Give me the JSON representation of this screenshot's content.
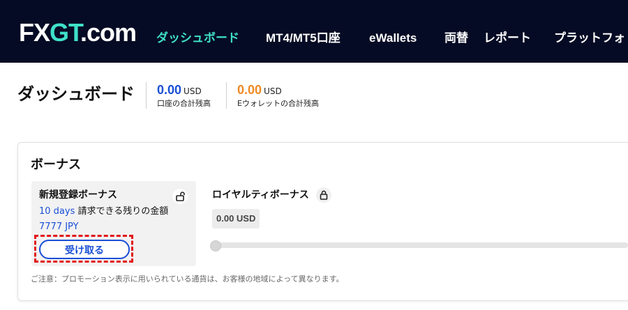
{
  "header": {
    "logo": {
      "prefix": "FX",
      "accent": "GT",
      "suffix": ".com"
    },
    "nav": [
      {
        "label": "ダッシュボード",
        "active": true
      },
      {
        "label": "MT4/MT5口座"
      },
      {
        "label": "eWallets"
      },
      {
        "label": "両替"
      },
      {
        "label": "レポート"
      },
      {
        "label": "プラットフォ"
      }
    ]
  },
  "dashboard": {
    "title": "ダッシュボード",
    "balances": [
      {
        "amount": "0.00",
        "currency": "USD",
        "label": "口座の合計残高"
      },
      {
        "amount": "0.00",
        "currency": "USD",
        "label": "Eウォレットの合計残高"
      }
    ]
  },
  "bonus": {
    "title": "ボーナス",
    "signup": {
      "title": "新規登録ボーナス",
      "days": "10 days",
      "claimable_text": "請求できる残りの金額",
      "amount": "7777 JPY",
      "button_label": "受け取る",
      "lock_icon": "unlock-icon"
    },
    "loyalty": {
      "title": "ロイヤルティボーナス",
      "amount": "0.00 USD",
      "progress": 0,
      "lock_icon": "lock-icon"
    },
    "note": "ご注意：プロモーション表示に用いられている通貨は、お客様の地域によって異なります。"
  },
  "colors": {
    "accent_teal": "#3fe0c8",
    "primary_blue": "#1a4fd6",
    "orange": "#f08a24",
    "header_bg": "#050b24",
    "highlight_red": "#e31515"
  }
}
